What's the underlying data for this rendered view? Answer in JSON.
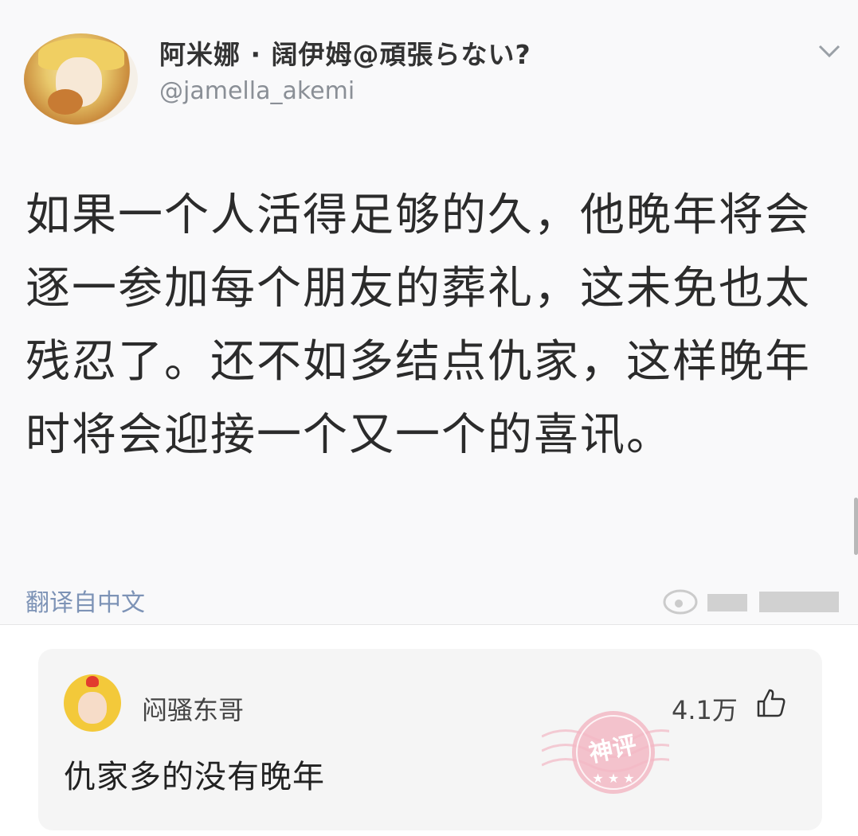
{
  "tweet": {
    "display_name": "阿米娜 · 阔伊姆@頑張らない?",
    "handle": "@jamella_akemi",
    "text": "如果一个人活得足够的久，他晚年将会逐一参加每个朋友的葬礼，这未免也太残忍了。还不如多结点仇家，这样晚年时将会迎接一个又一个的喜讯。",
    "translate_label": "翻译自中文",
    "avatar_icon": "anime-avatar-icon",
    "menu_icon": "chevron-down-icon"
  },
  "comment": {
    "author": "闷骚东哥",
    "likes": "4.1万",
    "text": "仇家多的没有晚年",
    "stamp_text": "神评",
    "like_icon": "thumbs-up-icon"
  },
  "colors": {
    "link": "#7d93b6",
    "stamp": "#f2b8c4",
    "card_bg": "#f5f5f5"
  }
}
